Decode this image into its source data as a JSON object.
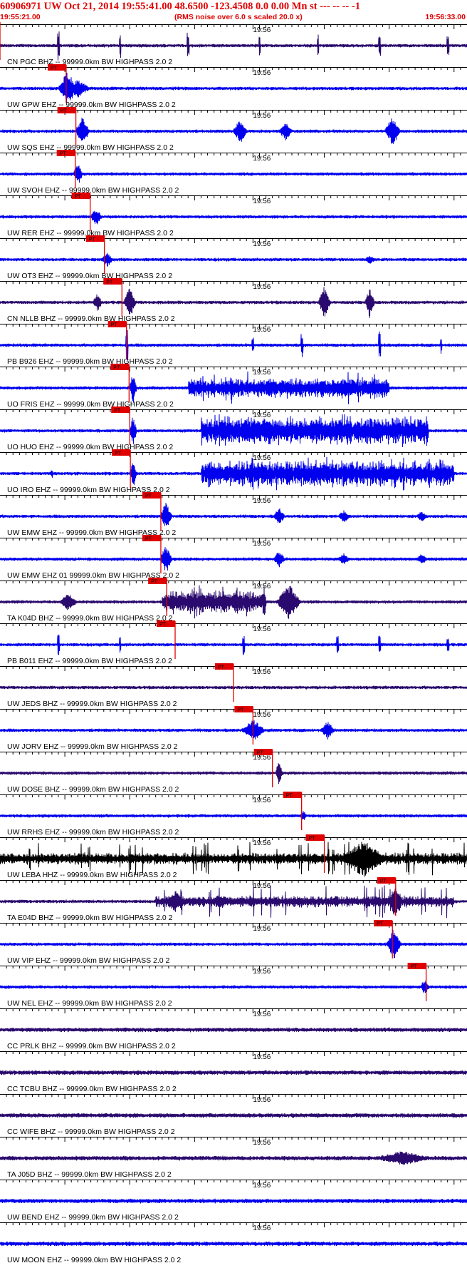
{
  "header": {
    "title": "60906971 UW Oct 21, 2014 19:55:41.00   48.6500 -123.4508  0.0 0.00 Mn st --- -- --   -1",
    "start_time": "19:55:21.00",
    "subtitle": "(RMS noise over 6.0 s scaled 20.0 x)",
    "end_time": "19:56:33.00"
  },
  "colors": {
    "header_text": "#e00000",
    "pick": "#e00000",
    "trace_navy": "#2a0a6e",
    "trace_blue": "#0000ee",
    "trace_black": "#000000",
    "axis": "#000000"
  },
  "chart_data": {
    "type": "line",
    "x_unit": "time (UTC)",
    "x_start": "19:55:21.00",
    "x_end": "19:56:33.00",
    "x_range_seconds": [
      0,
      72
    ],
    "minute_tick_label": "19:56",
    "minute_tick_seconds": 39,
    "pick_label": "PT",
    "series": [
      {
        "name": "CN PGC BHZ -- 99999.0km BW  HIGHPASS  2.0  2",
        "color": "#2a0a6e",
        "style": "spikes",
        "pick_seconds": 0.0,
        "events": [
          [
            9,
            0.85,
            0.3
          ],
          [
            18.5,
            0.7,
            0.3
          ],
          [
            29,
            0.75,
            0.3
          ],
          [
            40,
            0.55,
            0.3
          ],
          [
            49,
            0.6,
            0.3
          ],
          [
            58.5,
            0.6,
            0.3
          ],
          [
            69,
            0.65,
            0.3
          ]
        ]
      },
      {
        "name": "UW GPW EHZ -- 99999.0km BW  HIGHPASS  2.0  2",
        "color": "#0000ee",
        "style": "event",
        "pick_seconds": 10.2,
        "events": [
          [
            10.4,
            1.0,
            1.5
          ],
          [
            12,
            0.5,
            2
          ]
        ]
      },
      {
        "name": "UW SQS EHZ -- 99999.0km BW  HIGHPASS  2.0  2",
        "color": "#0000ee",
        "style": "event",
        "pick_seconds": 11.7,
        "events": [
          [
            12.7,
            0.8,
            1.2
          ],
          [
            37,
            0.7,
            1.2
          ],
          [
            44,
            0.5,
            1.2
          ],
          [
            60.5,
            0.8,
            1.3
          ]
        ]
      },
      {
        "name": "UW SVOH EHZ -- 99999.0km BW  HIGHPASS  2.0  2",
        "color": "#0000ee",
        "style": "event",
        "pick_seconds": 11.6,
        "events": [
          [
            12,
            0.6,
            0.8
          ]
        ]
      },
      {
        "name": "UW RER EHZ -- 99999.0km BW  HIGHPASS  2.0  2",
        "color": "#0000ee",
        "style": "event",
        "pick_seconds": 13.9,
        "events": [
          [
            14.8,
            0.5,
            1
          ]
        ]
      },
      {
        "name": "UW OT3 EHZ -- 99999.0km BW  HIGHPASS  2.0  2",
        "color": "#0000ee",
        "style": "event",
        "pick_seconds": 16.1,
        "events": [
          [
            16.5,
            0.4,
            1
          ],
          [
            57,
            0.25,
            1
          ]
        ]
      },
      {
        "name": "CN NLLB BHZ -- 99999.0km BW  HIGHPASS  2.0  2",
        "color": "#2a0a6e",
        "style": "event",
        "pick_seconds": 18.8,
        "events": [
          [
            15,
            0.5,
            0.8
          ],
          [
            20,
            0.9,
            1
          ],
          [
            50,
            0.9,
            1
          ],
          [
            57,
            0.9,
            0.8
          ]
        ]
      },
      {
        "name": "PB B926 EHZ -- 99999.0km BW  HIGHPASS  2.0  2",
        "color": "#0000ee",
        "style": "spikes",
        "pick_seconds": 19.5,
        "events": [
          [
            19.5,
            1.0,
            0.3
          ],
          [
            39,
            0.4,
            0.3
          ],
          [
            46.5,
            0.7,
            0.3
          ],
          [
            58.5,
            0.8,
            0.3
          ],
          [
            68,
            0.5,
            0.3
          ]
        ]
      },
      {
        "name": "UO FRIS EHZ -- 99999.0km BW  HIGHPASS  2.0  2",
        "color": "#0000ee",
        "style": "burst",
        "pick_seconds": 19.9,
        "events": [
          [
            20.5,
            0.9,
            0.6
          ]
        ],
        "burst": [
          29,
          60,
          0.6
        ]
      },
      {
        "name": "UO HUO EHZ -- 99999.0km BW  HIGHPASS  2.0  2",
        "color": "#0000ee",
        "style": "burst",
        "pick_seconds": 20.0,
        "events": [
          [
            20.5,
            0.9,
            0.6
          ]
        ],
        "burst": [
          31,
          66,
          0.85
        ]
      },
      {
        "name": "UO IRO EHZ -- 99999.0km BW  HIGHPASS  2.0  2",
        "color": "#0000ee",
        "style": "burst",
        "pick_seconds": 20.1,
        "events": [
          [
            20.5,
            0.8,
            0.6
          ],
          [
            8,
            0.3,
            0.3
          ]
        ],
        "burst": [
          31,
          70,
          0.75
        ]
      },
      {
        "name": "UW EMW EHZ -- 99999.0km BW  HIGHPASS  2.0  2",
        "color": "#0000ee",
        "style": "event",
        "pick_seconds": 24.8,
        "events": [
          [
            25.6,
            0.8,
            1
          ],
          [
            43,
            0.5,
            1
          ],
          [
            53,
            0.35,
            1
          ],
          [
            65,
            0.3,
            1
          ]
        ]
      },
      {
        "name": "UW EMW EHZ 01 99999.0km BW  HIGHPASS  2.0  2",
        "color": "#0000ee",
        "style": "event",
        "pick_seconds": 24.8,
        "events": [
          [
            25.6,
            0.8,
            1
          ],
          [
            43,
            0.5,
            1
          ],
          [
            53,
            0.35,
            1
          ],
          [
            65,
            0.3,
            1
          ]
        ]
      },
      {
        "name": "TA K04D BHZ -- 99999.0km BW  HIGHPASS  2.0  2",
        "color": "#2a0a6e",
        "style": "burst",
        "pick_seconds": 25.7,
        "events": [
          [
            44.5,
            1.0,
            2
          ],
          [
            10.5,
            0.5,
            1.5
          ]
        ],
        "burst": [
          25,
          41,
          0.7
        ]
      },
      {
        "name": "PB B011 EHZ -- 99999.0km BW  HIGHPASS  2.0  2",
        "color": "#0000ee",
        "style": "spikes",
        "pick_seconds": 27.0,
        "events": [
          [
            9,
            0.6,
            0.3
          ],
          [
            18.5,
            0.5,
            0.3
          ],
          [
            37.5,
            0.6,
            0.3
          ],
          [
            52,
            0.5,
            0.3
          ],
          [
            58.5,
            0.5,
            0.3
          ],
          [
            69,
            0.4,
            0.3
          ]
        ]
      },
      {
        "name": "UW JEDS BHZ -- 99999.0km BW  HIGHPASS  2.0  2",
        "color": "#2a0a6e",
        "style": "event",
        "pick_seconds": 36.0,
        "events": []
      },
      {
        "name": "UW JORV EHZ -- 99999.0km BW  HIGHPASS  2.0  2",
        "color": "#0000ee",
        "style": "event",
        "pick_seconds": 39.0,
        "events": [
          [
            39,
            0.6,
            2
          ],
          [
            50.5,
            0.5,
            1.2
          ]
        ]
      },
      {
        "name": "UW DOSE BHZ -- 99999.0km BW  HIGHPASS  2.0  2",
        "color": "#2a0a6e",
        "style": "event",
        "pick_seconds": 42.0,
        "events": [
          [
            43,
            0.7,
            0.6
          ]
        ]
      },
      {
        "name": "UW RRHS EHZ -- 99999.0km BW  HIGHPASS  2.0  2",
        "color": "#0000ee",
        "style": "event",
        "pick_seconds": 46.5,
        "events": [
          [
            46.8,
            0.3,
            0.6
          ]
        ]
      },
      {
        "name": "UW LEBA HHZ -- 99999.0km BW  HIGHPASS  2.0  2",
        "color": "#000000",
        "style": "burst",
        "pick_seconds": 50.0,
        "events": [
          [
            56,
            1.0,
            4
          ]
        ],
        "burst": [
          0,
          72,
          0.35
        ]
      },
      {
        "name": "TA E04D BHZ -- 99999.0km BW  HIGHPASS  2.0  2",
        "color": "#2a0a6e",
        "style": "burst",
        "pick_seconds": 61.0,
        "events": [
          [
            61,
            1.0,
            1.2
          ],
          [
            27,
            0.6,
            2
          ],
          [
            34,
            0.4,
            2
          ]
        ],
        "burst": [
          24,
          70,
          0.35
        ]
      },
      {
        "name": "UW VIP EHZ -- 99999.0km BW  HIGHPASS  2.0  2",
        "color": "#0000ee",
        "style": "event",
        "pick_seconds": 60.5,
        "events": [
          [
            60.7,
            0.9,
            1.2
          ]
        ]
      },
      {
        "name": "UW NEL EHZ -- 99999.0km BW  HIGHPASS  2.0  2",
        "color": "#0000ee",
        "style": "event",
        "pick_seconds": 65.7,
        "events": [
          [
            65.5,
            0.45,
            0.8
          ]
        ]
      },
      {
        "name": "CC PRLK BHZ -- 99999.0km BW  HIGHPASS  2.0  2",
        "color": "#2a0a6e",
        "style": "noise",
        "events": []
      },
      {
        "name": "CC TCBU BHZ -- 99999.0km BW  HIGHPASS  2.0  2",
        "color": "#2a0a6e",
        "style": "noise",
        "events": []
      },
      {
        "name": "CC WIFE BHZ -- 99999.0km BW  HIGHPASS  2.0  2",
        "color": "#2a0a6e",
        "style": "noise",
        "events": []
      },
      {
        "name": "TA J05D BHZ -- 99999.0km BW  HIGHPASS  2.0  2",
        "color": "#2a0a6e",
        "style": "noise",
        "events": [
          [
            62,
            0.4,
            5
          ]
        ]
      },
      {
        "name": "UW BEND EHZ -- 99999.0km BW  HIGHPASS  2.0  2",
        "color": "#0000ee",
        "style": "noise",
        "events": []
      },
      {
        "name": "UW MOON EHZ -- 99999.0km BW  HIGHPASS  2.0  2",
        "color": "#0000ee",
        "style": "noise",
        "events": []
      }
    ]
  }
}
